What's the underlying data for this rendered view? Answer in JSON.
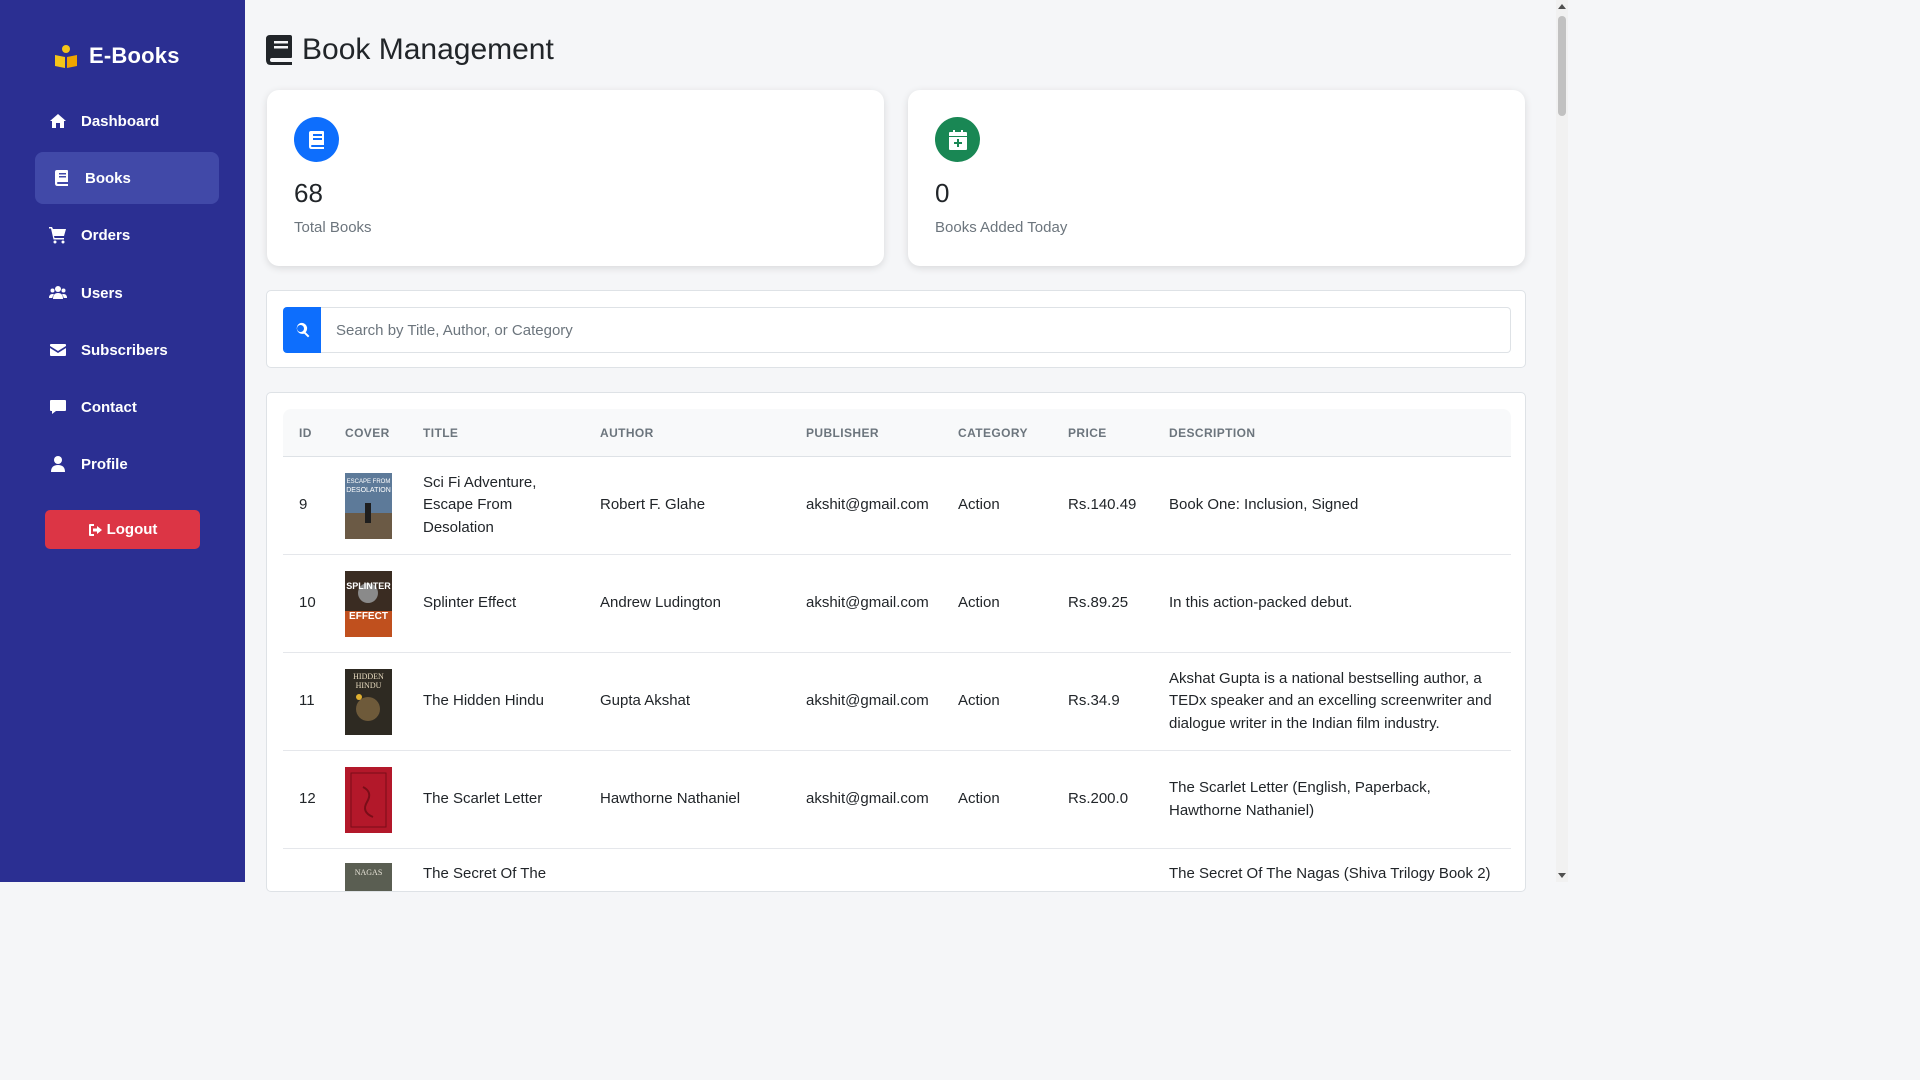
{
  "sidebar": {
    "brand": "E-Books",
    "items": [
      {
        "label": "Dashboard",
        "icon": "home-icon"
      },
      {
        "label": "Books",
        "icon": "book-icon",
        "active": true
      },
      {
        "label": "Orders",
        "icon": "cart-icon"
      },
      {
        "label": "Users",
        "icon": "users-icon"
      },
      {
        "label": "Subscribers",
        "icon": "envelope-icon"
      },
      {
        "label": "Contact",
        "icon": "comment-icon"
      },
      {
        "label": "Profile",
        "icon": "user-icon"
      }
    ],
    "logout_label": "Logout"
  },
  "header": {
    "title": "Book Management"
  },
  "stats": [
    {
      "value": "68",
      "label": "Total Books",
      "color": "#0d6efd",
      "icon": "book-icon"
    },
    {
      "value": "0",
      "label": "Books Added Today",
      "color": "#198754",
      "icon": "calendar-plus-icon"
    }
  ],
  "search": {
    "placeholder": "Search by Title, Author, or Category",
    "value": ""
  },
  "table": {
    "columns": [
      "ID",
      "COVER",
      "TITLE",
      "AUTHOR",
      "PUBLISHER",
      "CATEGORY",
      "PRICE",
      "DESCRIPTION"
    ],
    "rows": [
      {
        "id": "9",
        "title": "Sci Fi Adventure, Escape From Desolation",
        "author": "Robert F. Glahe",
        "publisher": "akshit@gmail.com",
        "category": "Action",
        "price": "Rs.140.49",
        "description": "Book One: Inclusion, Signed",
        "cover_color": "#4a5f7a",
        "cover_text": "ESCAPE FROM DESOLATION"
      },
      {
        "id": "10",
        "title": "Splinter Effect",
        "author": "Andrew Ludington",
        "publisher": "akshit@gmail.com",
        "category": "Action",
        "price": "Rs.89.25",
        "description": "In this action-packed debut.",
        "cover_color": "#3a2c22",
        "cover_text": "SPLINTER EFFECT"
      },
      {
        "id": "11",
        "title": "The Hidden Hindu",
        "author": "Gupta Akshat",
        "publisher": "akshit@gmail.com",
        "category": "Action",
        "price": "Rs.34.9",
        "description": "Akshat Gupta is a national bestselling author, a TEDx speaker and an excelling screenwriter and dialogue writer in the Indian film industry.",
        "cover_color": "#2e2a22",
        "cover_text": "HIDDEN HINDU"
      },
      {
        "id": "12",
        "title": "The Scarlet Letter",
        "author": "Hawthorne Nathaniel",
        "publisher": "akshit@gmail.com",
        "category": "Action",
        "price": "Rs.200.0",
        "description": "The Scarlet Letter (English, Paperback, Hawthorne Nathaniel)",
        "cover_color": "#b3182a",
        "cover_text": ""
      },
      {
        "id": "",
        "title": "The Secret Of The",
        "author": "",
        "publisher": "",
        "category": "",
        "price": "",
        "description": "The Secret Of The Nagas (Shiva Trilogy Book 2)",
        "cover_color": "#5a5e52",
        "cover_text": "NAGAS"
      }
    ]
  }
}
